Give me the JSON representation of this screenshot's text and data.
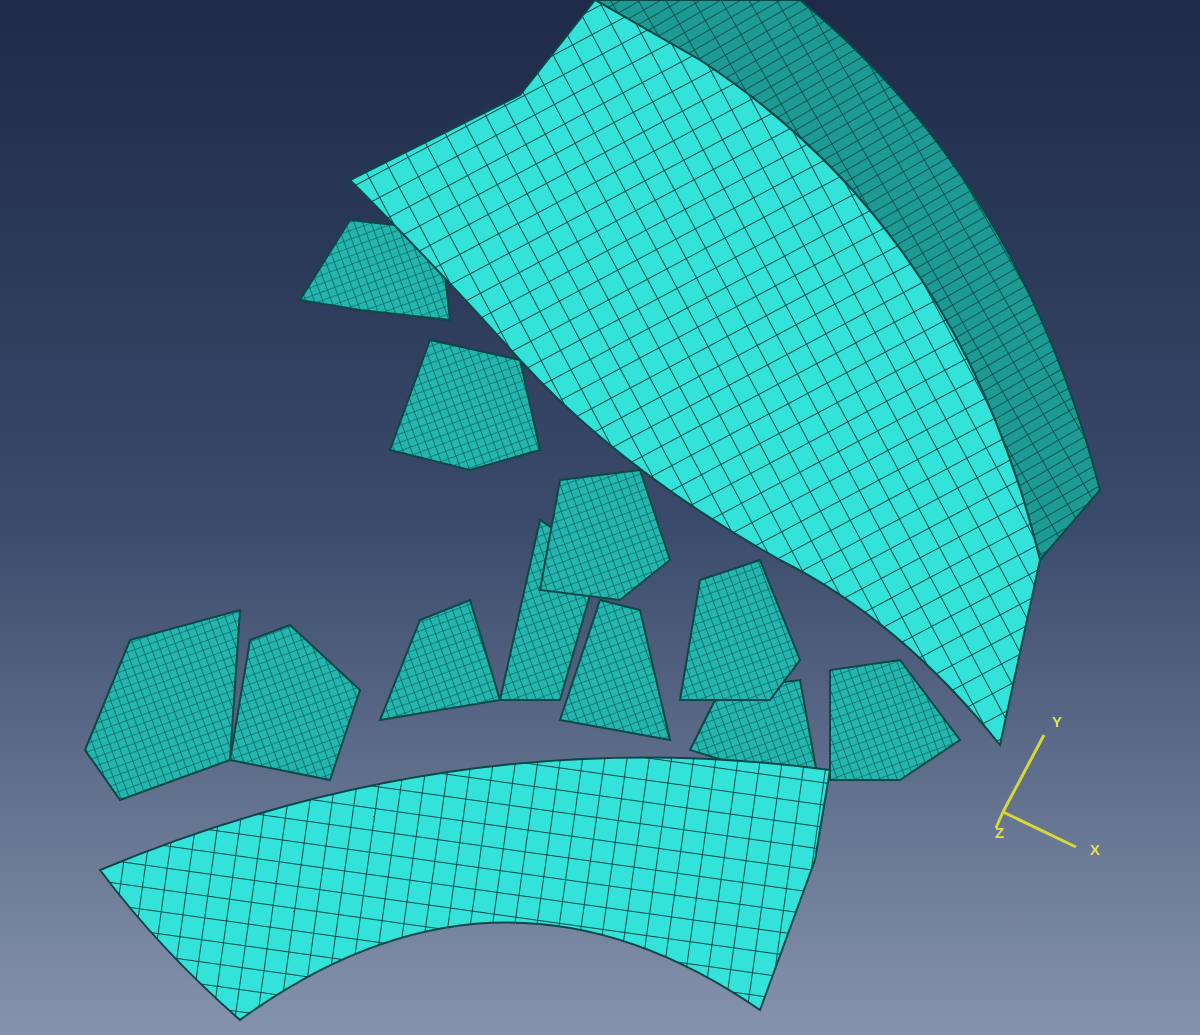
{
  "viewport": {
    "triad": {
      "axes": [
        {
          "kind": "y",
          "label": "Y"
        },
        {
          "kind": "z",
          "label": "Z"
        },
        {
          "kind": "x",
          "label": "X"
        }
      ]
    }
  }
}
